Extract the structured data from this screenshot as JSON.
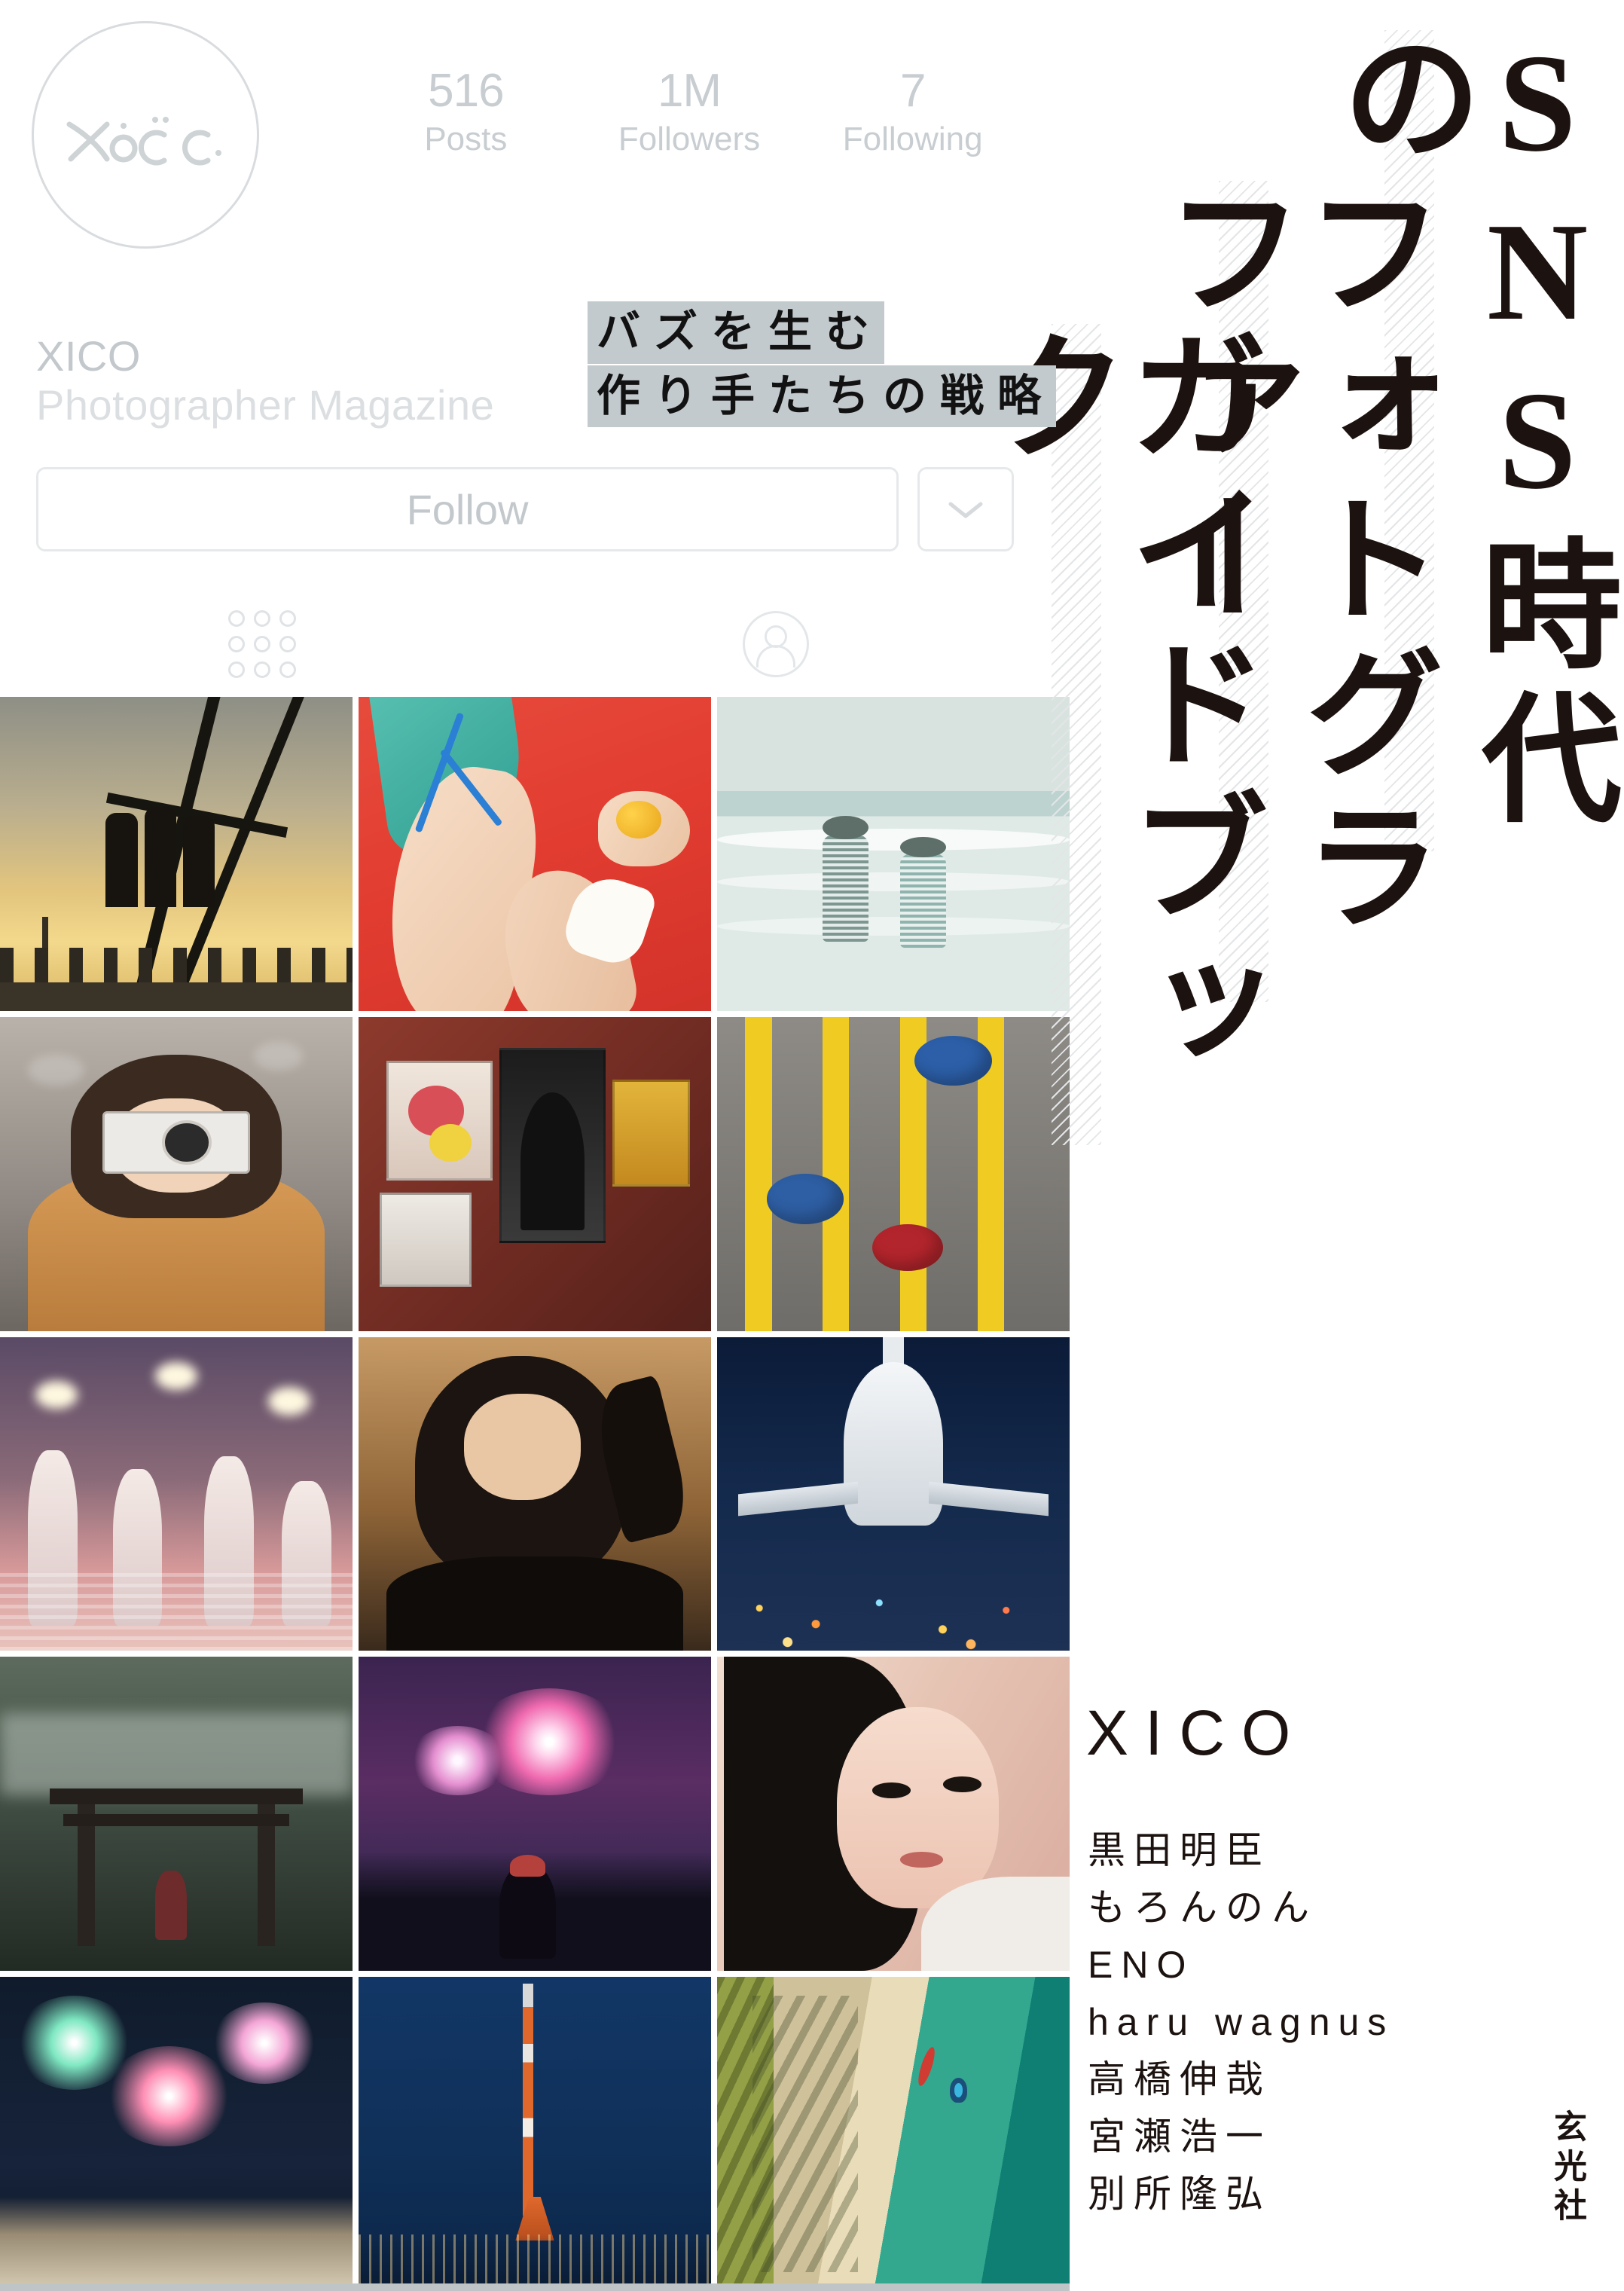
{
  "profile": {
    "avatar_logo": "xico-script-logo",
    "username": "XICO",
    "bio": "Photographer Magazine",
    "follow_label": "Follow",
    "dropdown_icon": "chevron-down-icon",
    "stats": [
      {
        "value": "516",
        "label": "Posts"
      },
      {
        "value": "1M",
        "label": "Followers"
      },
      {
        "value": "7",
        "label": "Following"
      }
    ],
    "tabs": [
      {
        "icon": "grid-icon",
        "name": "posts-grid-tab"
      },
      {
        "icon": "person-tagged-icon",
        "name": "tagged-tab"
      }
    ]
  },
  "catch_copy": {
    "line1": "バズを生む",
    "line2": "作り手たちの戦略",
    "highlight_color": "#c3cace"
  },
  "title": {
    "column1": "SNS時代の",
    "column2": "フォトグラファー",
    "column3": "ガイドブック",
    "full": "SNS時代のフォトグラファーガイドブック"
  },
  "authors": {
    "brand": "XICO",
    "names": [
      "黒田明臣",
      "もろんのん",
      "ENO",
      "haru wagnus",
      "高橋伸哉",
      "宮瀬浩一",
      "別所隆弘"
    ]
  },
  "publisher": "玄光社",
  "photo_grid": [
    {
      "alt": "rooftop-silhouettes-sunset-city"
    },
    {
      "alt": "red-teal-swimsuit-lemon"
    },
    {
      "alt": "two-girls-in-sea-foam"
    },
    {
      "alt": "woman-holding-film-camera-street"
    },
    {
      "alt": "street-art-posters-red-wall"
    },
    {
      "alt": "aerial-yellow-crosswalk-umbrellas"
    },
    {
      "alt": "women-in-white-dresses-pink-water"
    },
    {
      "alt": "portrait-woman-desert-dunes"
    },
    {
      "alt": "airplane-night-runway-lights"
    },
    {
      "alt": "misty-forest-torii-gate"
    },
    {
      "alt": "fireworks-and-watcher-silhouette"
    },
    {
      "alt": "close-up-portrait-short-hair"
    },
    {
      "alt": "hanabi-fireworks-over-shore"
    },
    {
      "alt": "tokyo-tower-night-blue"
    },
    {
      "alt": "aerial-beach-palm-shadows-boats"
    }
  ],
  "colors": {
    "ui_gray": "#c8cdd1",
    "border_gray": "#e6e9eb",
    "ink": "#1c1310",
    "hatch": "#e3e5e7"
  }
}
